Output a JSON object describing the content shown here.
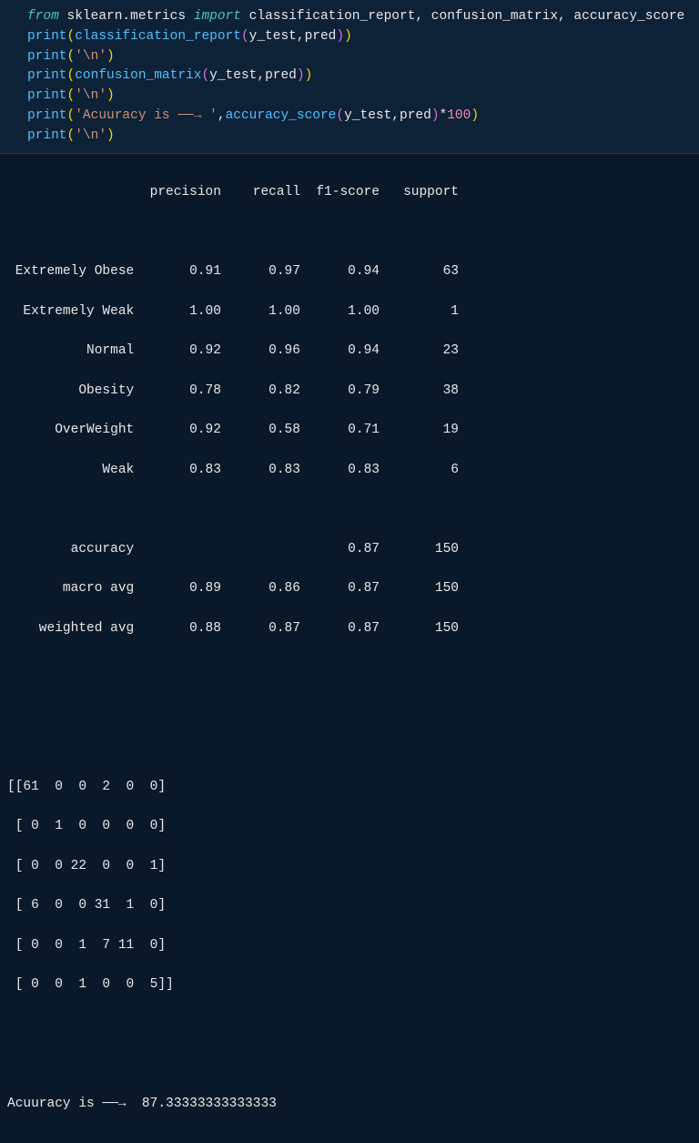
{
  "code": {
    "line1": {
      "from": "from",
      "module": "sklearn.metrics",
      "import": "import",
      "items": "classification_report, confusion_matrix, accuracy_score"
    },
    "line2": {
      "fn": "print",
      "call": "classification_report",
      "args": "y_test,pred"
    },
    "line3": {
      "fn": "print",
      "str": "'\\n'"
    },
    "line4": {
      "fn": "print",
      "call": "confusion_matrix",
      "args": "y_test,pred"
    },
    "line5": {
      "fn": "print",
      "str": "'\\n'"
    },
    "line6": {
      "fn": "print",
      "str": "'Acuuracy is ──→ '",
      "call": "accuracy_score",
      "args": "y_test,pred",
      "mult": "100"
    },
    "line7": {
      "fn": "print",
      "str": "'\\n'"
    }
  },
  "report": {
    "header": "                  precision    recall  f1-score   support",
    "rows": [
      " Extremely Obese       0.91      0.97      0.94        63",
      "  Extremely Weak       1.00      1.00      1.00         1",
      "          Normal       0.92      0.96      0.94        23",
      "         Obesity       0.78      0.82      0.79        38",
      "      OverWeight       0.92      0.58      0.71        19",
      "            Weak       0.83      0.83      0.83         6"
    ],
    "summary": [
      "        accuracy                           0.87       150",
      "       macro avg       0.89      0.86      0.87       150",
      "    weighted avg       0.88      0.87      0.87       150"
    ]
  },
  "confusion_matrix": [
    "[[61  0  0  2  0  0]",
    " [ 0  1  0  0  0  0]",
    " [ 0  0 22  0  0  1]",
    " [ 6  0  0 31  1  0]",
    " [ 0  0  1  7 11  0]",
    " [ 0  0  1  0  0  5]]"
  ],
  "accuracy_line": "Acuuracy is ──→  87.33333333333333"
}
